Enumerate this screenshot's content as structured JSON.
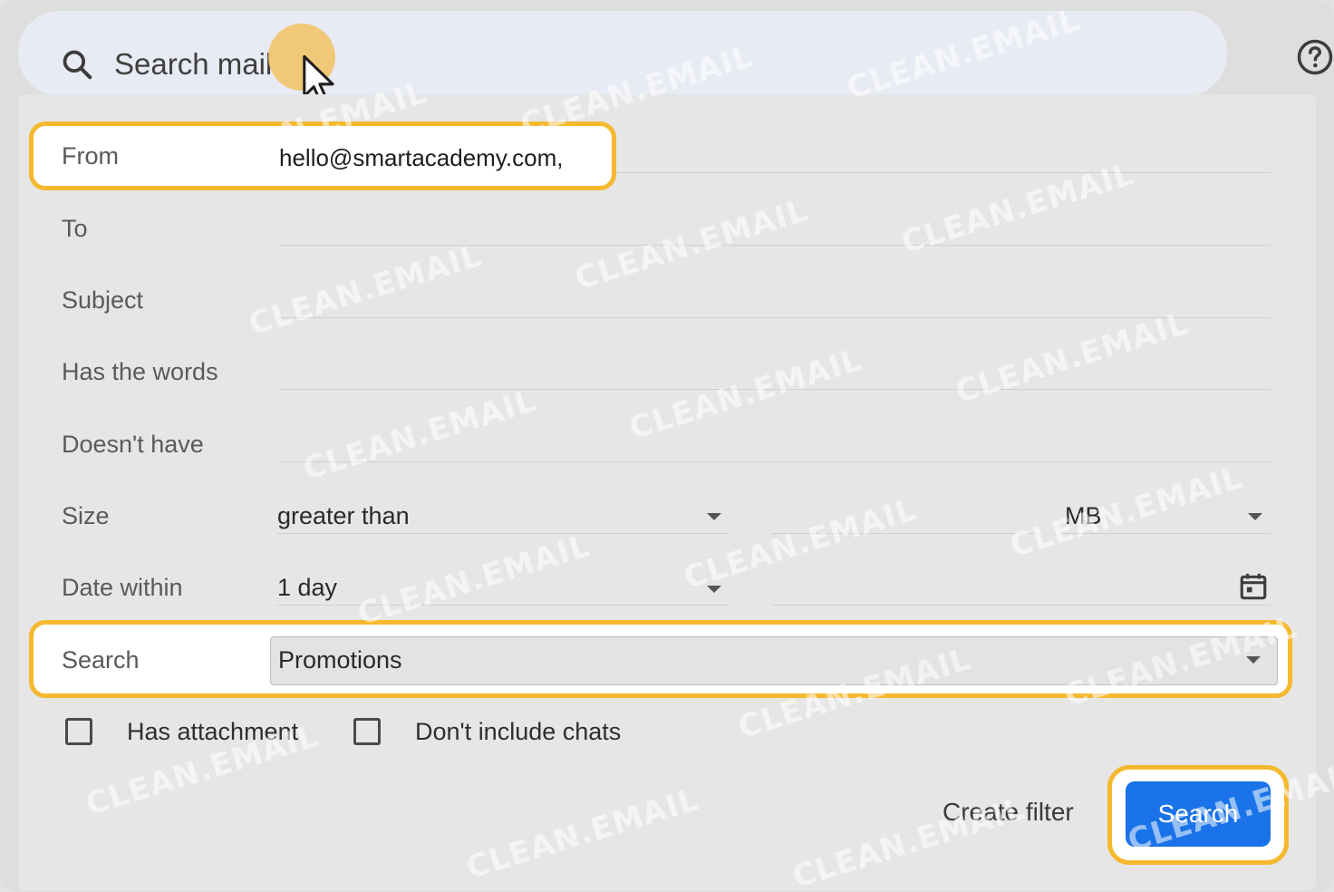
{
  "search_bar": {
    "placeholder": "Search mail"
  },
  "form": {
    "from": {
      "label": "From",
      "value": "hello@smartacademy.com,"
    },
    "to": {
      "label": "To",
      "value": ""
    },
    "subject": {
      "label": "Subject",
      "value": ""
    },
    "has_words": {
      "label": "Has the words",
      "value": ""
    },
    "doesnt_have": {
      "label": "Doesn't have",
      "value": ""
    },
    "size": {
      "label": "Size",
      "comparator": "greater than",
      "unit": "MB"
    },
    "date_within": {
      "label": "Date within",
      "value": "1 day"
    },
    "search_in": {
      "label": "Search",
      "value": "Promotions"
    },
    "has_attachment": {
      "label": "Has attachment",
      "checked": false
    },
    "dont_include_chats": {
      "label": "Don't include chats",
      "checked": false
    }
  },
  "actions": {
    "create_filter": "Create filter",
    "search": "Search"
  },
  "watermark": "CLEAN.EMAIL",
  "colors": {
    "highlight": "#f5b92f",
    "primary_button": "#1a73e8",
    "cursor_halo": "#f2c46a"
  },
  "icons": [
    "search-icon",
    "help-icon",
    "calendar-icon",
    "dropdown-arrow-icon",
    "cursor-icon"
  ]
}
